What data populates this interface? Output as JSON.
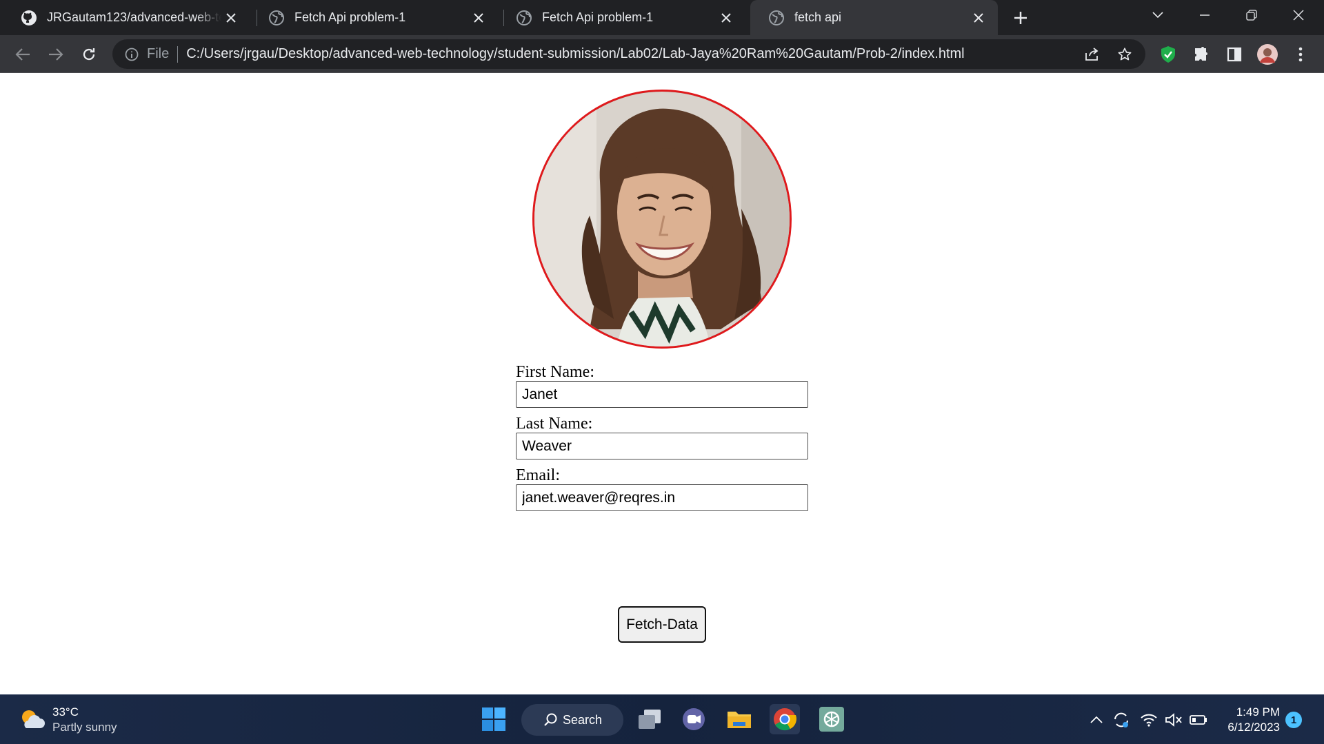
{
  "browser": {
    "tabs": [
      {
        "title": "JRGautam123/advanced-web-tec",
        "favicon": "github-icon",
        "active": false
      },
      {
        "title": "Fetch Api problem-1",
        "favicon": "globe-icon",
        "active": false
      },
      {
        "title": "Fetch Api problem-1",
        "favicon": "globe-icon",
        "active": false
      },
      {
        "title": "fetch api",
        "favicon": "globe-icon",
        "active": true
      }
    ],
    "address_bar": {
      "scheme_label": "File",
      "url": "C:/Users/jrgau/Desktop/advanced-web-technology/student-submission/Lab02/Lab-Jaya%20Ram%20Gautam/Prob-2/index.html"
    }
  },
  "form": {
    "first_name_label": "First Name:",
    "first_name_value": "Janet",
    "last_name_label": "Last Name:",
    "last_name_value": "Weaver",
    "email_label": "Email:",
    "email_value": "janet.weaver@reqres.in",
    "button_label": "Fetch-Data"
  },
  "colors": {
    "avatar_border": "#e0191c",
    "tab_strip": "#202124",
    "toolbar": "#35363a",
    "taskbar": "#15233d"
  },
  "taskbar": {
    "weather": {
      "temperature": "33°C",
      "condition": "Partly sunny"
    },
    "search_label": "Search",
    "clock": {
      "time": "1:49 PM",
      "date": "6/12/2023"
    },
    "notification_count": "1"
  }
}
